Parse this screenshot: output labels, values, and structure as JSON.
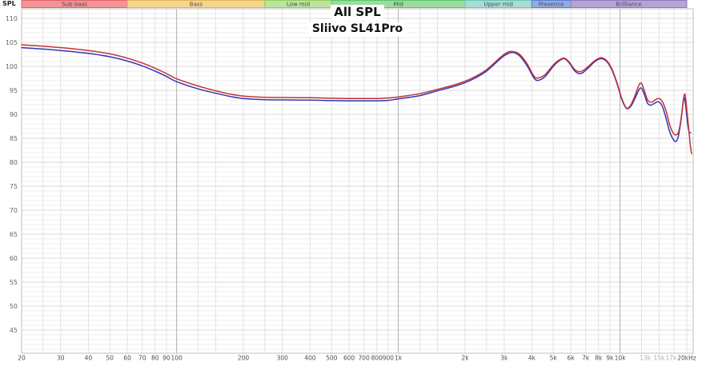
{
  "header": {
    "axis_corner_label": "SPL"
  },
  "chart_data": {
    "type": "line",
    "title": "All SPL",
    "subtitle": "Sliivo SL41Pro",
    "x_scale": "log",
    "x_unit": "Hz",
    "xlim": [
      20,
      21500
    ],
    "ylim": [
      40,
      112
    ],
    "grid": true,
    "legend": "none",
    "y_ticks": [
      110,
      105,
      100,
      95,
      90,
      85,
      80,
      75,
      70,
      65,
      60,
      55,
      50,
      45
    ],
    "x_ticks": [
      {
        "f": 20,
        "label": "20"
      },
      {
        "f": 30,
        "label": "30"
      },
      {
        "f": 40,
        "label": "40"
      },
      {
        "f": 50,
        "label": "50"
      },
      {
        "f": 60,
        "label": "60"
      },
      {
        "f": 70,
        "label": "70"
      },
      {
        "f": 80,
        "label": "80"
      },
      {
        "f": 90,
        "label": "90"
      },
      {
        "f": 100,
        "label": "100"
      },
      {
        "f": 200,
        "label": "200"
      },
      {
        "f": 300,
        "label": "300"
      },
      {
        "f": 400,
        "label": "400"
      },
      {
        "f": 500,
        "label": "500"
      },
      {
        "f": 600,
        "label": "600"
      },
      {
        "f": 700,
        "label": "700"
      },
      {
        "f": 800,
        "label": "800"
      },
      {
        "f": 900,
        "label": "900"
      },
      {
        "f": 1000,
        "label": "1k"
      },
      {
        "f": 2000,
        "label": "2k"
      },
      {
        "f": 3000,
        "label": "3k"
      },
      {
        "f": 4000,
        "label": "4k"
      },
      {
        "f": 5000,
        "label": "5k"
      },
      {
        "f": 6000,
        "label": "6k"
      },
      {
        "f": 7000,
        "label": "7k"
      },
      {
        "f": 8000,
        "label": "8k"
      },
      {
        "f": 9000,
        "label": "9k"
      },
      {
        "f": 10000,
        "label": "10k"
      },
      {
        "f": 13000,
        "label": "13k",
        "muted": true
      },
      {
        "f": 15000,
        "label": "15k",
        "muted": true
      },
      {
        "f": 17000,
        "label": "17k",
        "muted": true
      },
      {
        "f": 20000,
        "label": "20kHz"
      }
    ],
    "minor_grid_freqs": [
      25,
      30,
      40,
      50,
      60,
      70,
      80,
      90,
      125,
      150,
      200,
      250,
      300,
      400,
      500,
      600,
      700,
      800,
      900,
      1250,
      1500,
      2000,
      2500,
      3000,
      4000,
      5000,
      6000,
      7000,
      8000,
      9000,
      12500,
      15000,
      17500,
      20000
    ],
    "major_grid_freqs": [
      100,
      1000,
      10000
    ],
    "frequency_bands": [
      {
        "label": "Sub bass",
        "from": 20,
        "to": 60,
        "fill": "#f29395",
        "border": "#e06568"
      },
      {
        "label": "Bass",
        "from": 60,
        "to": 250,
        "fill": "#f6d68d",
        "border": "#dfb257"
      },
      {
        "label": "Low mid",
        "from": 250,
        "to": 500,
        "fill": "#bce49c",
        "border": "#8fd060"
      },
      {
        "label": "Mid",
        "from": 500,
        "to": 2000,
        "fill": "#9cdc9e",
        "border": "#5cc46a"
      },
      {
        "label": "Upper mid",
        "from": 2000,
        "to": 4000,
        "fill": "#a8dcd2",
        "border": "#66c6bd"
      },
      {
        "label": "Presence",
        "from": 4000,
        "to": 6000,
        "fill": "#93abdf",
        "border": "#5c7fd0"
      },
      {
        "label": "Brilliance",
        "from": 6000,
        "to": 20000,
        "fill": "#b2a5d5",
        "border": "#8d7bbd"
      }
    ],
    "series": [
      {
        "name": "blue-trace",
        "color": "#3338b0",
        "points": [
          [
            20,
            103.9
          ],
          [
            25,
            103.6
          ],
          [
            30,
            103.3
          ],
          [
            40,
            102.7
          ],
          [
            50,
            102.0
          ],
          [
            60,
            101.1
          ],
          [
            70,
            100.1
          ],
          [
            80,
            99.0
          ],
          [
            90,
            97.9
          ],
          [
            100,
            96.8
          ],
          [
            125,
            95.3
          ],
          [
            150,
            94.4
          ],
          [
            175,
            93.7
          ],
          [
            200,
            93.3
          ],
          [
            250,
            93.05
          ],
          [
            300,
            93.0
          ],
          [
            400,
            92.95
          ],
          [
            500,
            92.85
          ],
          [
            600,
            92.8
          ],
          [
            700,
            92.8
          ],
          [
            800,
            92.8
          ],
          [
            900,
            92.9
          ],
          [
            1000,
            93.2
          ],
          [
            1250,
            93.9
          ],
          [
            1500,
            94.9
          ],
          [
            1750,
            95.7
          ],
          [
            2000,
            96.6
          ],
          [
            2250,
            97.7
          ],
          [
            2500,
            99.0
          ],
          [
            2750,
            100.7
          ],
          [
            3000,
            102.2
          ],
          [
            3250,
            102.9
          ],
          [
            3500,
            102.3
          ],
          [
            3800,
            100.2
          ],
          [
            4100,
            97.5
          ],
          [
            4300,
            97.1
          ],
          [
            4600,
            97.9
          ],
          [
            5000,
            100.0
          ],
          [
            5300,
            101.1
          ],
          [
            5600,
            101.6
          ],
          [
            5900,
            100.7
          ],
          [
            6200,
            99.2
          ],
          [
            6500,
            98.5
          ],
          [
            6800,
            98.7
          ],
          [
            7200,
            99.7
          ],
          [
            7700,
            101.0
          ],
          [
            8200,
            101.6
          ],
          [
            8700,
            101.0
          ],
          [
            9200,
            99.2
          ],
          [
            9700,
            96.3
          ],
          [
            10200,
            93.0
          ],
          [
            10700,
            91.2
          ],
          [
            11200,
            91.7
          ],
          [
            11700,
            93.4
          ],
          [
            12200,
            95.2
          ],
          [
            12500,
            95.4
          ],
          [
            12900,
            94.0
          ],
          [
            13300,
            92.3
          ],
          [
            13800,
            91.9
          ],
          [
            14300,
            92.3
          ],
          [
            14900,
            92.6
          ],
          [
            15500,
            91.7
          ],
          [
            16100,
            89.3
          ],
          [
            16700,
            86.5
          ],
          [
            17300,
            84.9
          ],
          [
            17800,
            84.3
          ],
          [
            18300,
            85.3
          ],
          [
            18800,
            88.5
          ],
          [
            19200,
            92.0
          ],
          [
            19500,
            93.4
          ],
          [
            19800,
            91.5
          ],
          [
            20200,
            87.8
          ],
          [
            20500,
            86.3
          ],
          [
            20800,
            86.2
          ]
        ]
      },
      {
        "name": "red-trace",
        "color": "#c23237",
        "points": [
          [
            20,
            104.5
          ],
          [
            25,
            104.2
          ],
          [
            30,
            103.9
          ],
          [
            40,
            103.3
          ],
          [
            50,
            102.6
          ],
          [
            60,
            101.7
          ],
          [
            70,
            100.7
          ],
          [
            80,
            99.6
          ],
          [
            90,
            98.5
          ],
          [
            100,
            97.4
          ],
          [
            125,
            95.9
          ],
          [
            150,
            94.9
          ],
          [
            175,
            94.2
          ],
          [
            200,
            93.8
          ],
          [
            250,
            93.55
          ],
          [
            300,
            93.5
          ],
          [
            400,
            93.45
          ],
          [
            500,
            93.35
          ],
          [
            600,
            93.3
          ],
          [
            700,
            93.3
          ],
          [
            800,
            93.3
          ],
          [
            900,
            93.4
          ],
          [
            1000,
            93.6
          ],
          [
            1250,
            94.3
          ],
          [
            1500,
            95.2
          ],
          [
            1750,
            96.0
          ],
          [
            2000,
            96.9
          ],
          [
            2250,
            98.0
          ],
          [
            2500,
            99.3
          ],
          [
            2750,
            101.0
          ],
          [
            3000,
            102.5
          ],
          [
            3200,
            103.1
          ],
          [
            3500,
            102.6
          ],
          [
            3800,
            100.6
          ],
          [
            4100,
            97.9
          ],
          [
            4300,
            97.6
          ],
          [
            4600,
            98.3
          ],
          [
            5000,
            100.3
          ],
          [
            5300,
            101.3
          ],
          [
            5600,
            101.7
          ],
          [
            5900,
            100.9
          ],
          [
            6200,
            99.5
          ],
          [
            6500,
            98.9
          ],
          [
            6800,
            99.1
          ],
          [
            7200,
            100.0
          ],
          [
            7700,
            101.2
          ],
          [
            8200,
            101.8
          ],
          [
            8700,
            101.2
          ],
          [
            9200,
            99.4
          ],
          [
            9700,
            96.5
          ],
          [
            10200,
            93.2
          ],
          [
            10700,
            91.3
          ],
          [
            11200,
            92.0
          ],
          [
            11700,
            94.0
          ],
          [
            12200,
            96.2
          ],
          [
            12500,
            96.4
          ],
          [
            12900,
            94.8
          ],
          [
            13300,
            93.0
          ],
          [
            13800,
            92.5
          ],
          [
            14300,
            92.9
          ],
          [
            14900,
            93.3
          ],
          [
            15500,
            92.7
          ],
          [
            16100,
            90.8
          ],
          [
            16700,
            88.0
          ],
          [
            17300,
            86.2
          ],
          [
            17900,
            85.7
          ],
          [
            18400,
            86.5
          ],
          [
            18900,
            89.5
          ],
          [
            19300,
            93.0
          ],
          [
            19600,
            94.2
          ],
          [
            19900,
            92.0
          ],
          [
            20300,
            88.0
          ],
          [
            20700,
            84.0
          ],
          [
            21000,
            81.8
          ]
        ]
      }
    ]
  }
}
